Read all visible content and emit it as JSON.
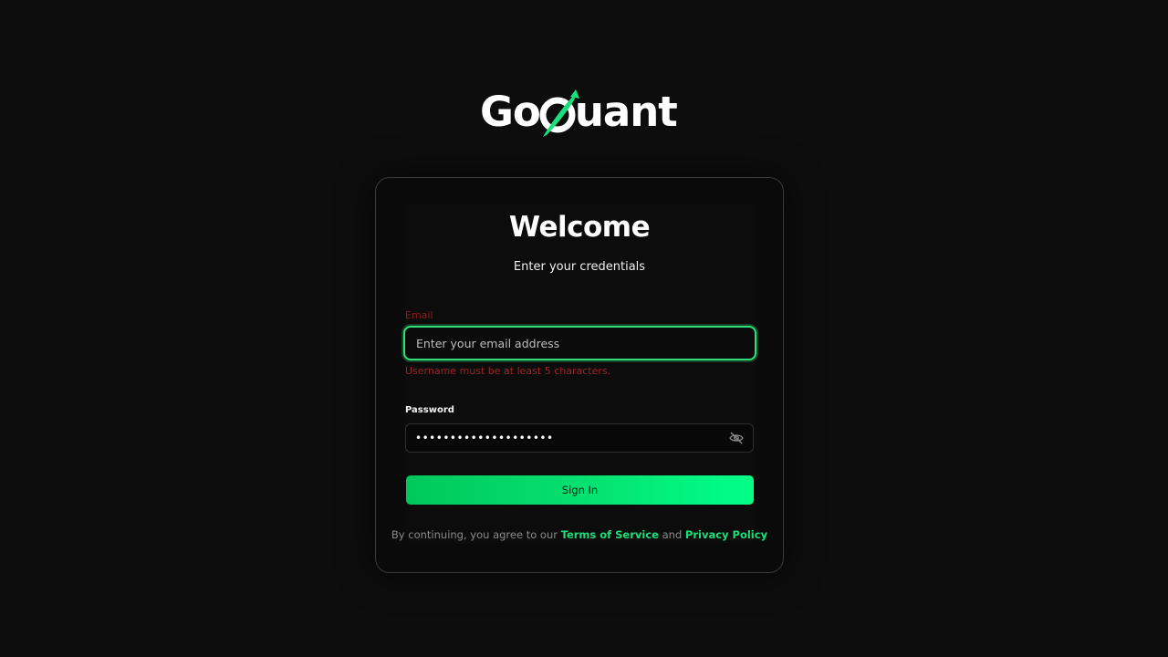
{
  "logo": {
    "text_before": "Go",
    "text_after": "uant",
    "accent_color": "#18e07a"
  },
  "card": {
    "title": "Welcome",
    "subtitle": "Enter your credentials"
  },
  "email": {
    "label": "Email",
    "placeholder": "Enter your email address",
    "value": "",
    "error": "Username must be at least 5 characters."
  },
  "password": {
    "label": "Password",
    "value": "••••••••••••••••••••",
    "toggle_icon": "eye-off-icon"
  },
  "signin": {
    "label": "Sign In"
  },
  "terms": {
    "prefix": "By continuing, you agree to our ",
    "tos_label": "Terms of Service",
    "and": " and ",
    "privacy_label": "Privacy Policy"
  },
  "colors": {
    "background": "#0d0d0d",
    "accent": "#18e07a",
    "error": "#9a2323"
  }
}
